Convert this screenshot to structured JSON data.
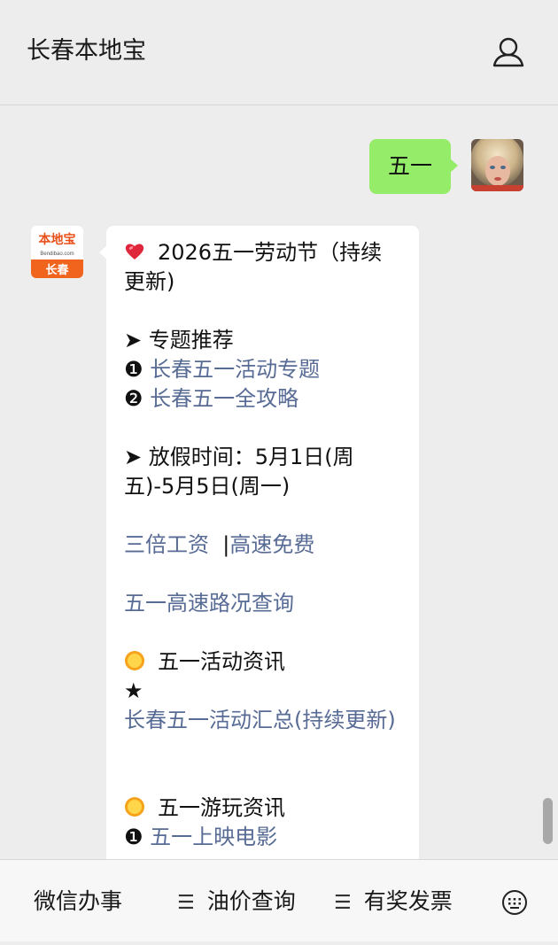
{
  "header": {
    "title": "长春本地宝",
    "user_icon": "user-icon"
  },
  "chat": {
    "user_message": "五一",
    "bot_avatar": {
      "logo_line1": "本地宝",
      "logo_line2": "Bendibao.com",
      "city": "长春"
    },
    "bot_message": {
      "title": "2026五一劳动节（持续",
      "title_cont": "更新)",
      "section1": "➤ 专题推荐",
      "link1_num": "❶",
      "link1": "长春五一活动专题",
      "link2_num": "❷",
      "link2": "长春五一全攻略",
      "holiday1": "➤ 放假时间：5月1日(周",
      "holiday2": "五)-5月5日(周一)",
      "link3": "三倍工资",
      "sep": "|",
      "link4": "高速免费",
      "link5": "五一高速路况查询",
      "section2": "五一活动资讯",
      "star": "★",
      "link6": "长春五一活动汇总(持续更新)",
      "section3": "五一游玩资讯",
      "link7_num": "❶",
      "link7": "五一上映电影"
    }
  },
  "menu": {
    "item1": "微信办事",
    "item2": "油价查询",
    "item3": "有奖发票",
    "menu_icon": "☰",
    "keyboard_icon": "keyboard-icon"
  },
  "colors": {
    "link": "#576b95",
    "user_bubble": "#95ec69",
    "background": "#ededed"
  }
}
